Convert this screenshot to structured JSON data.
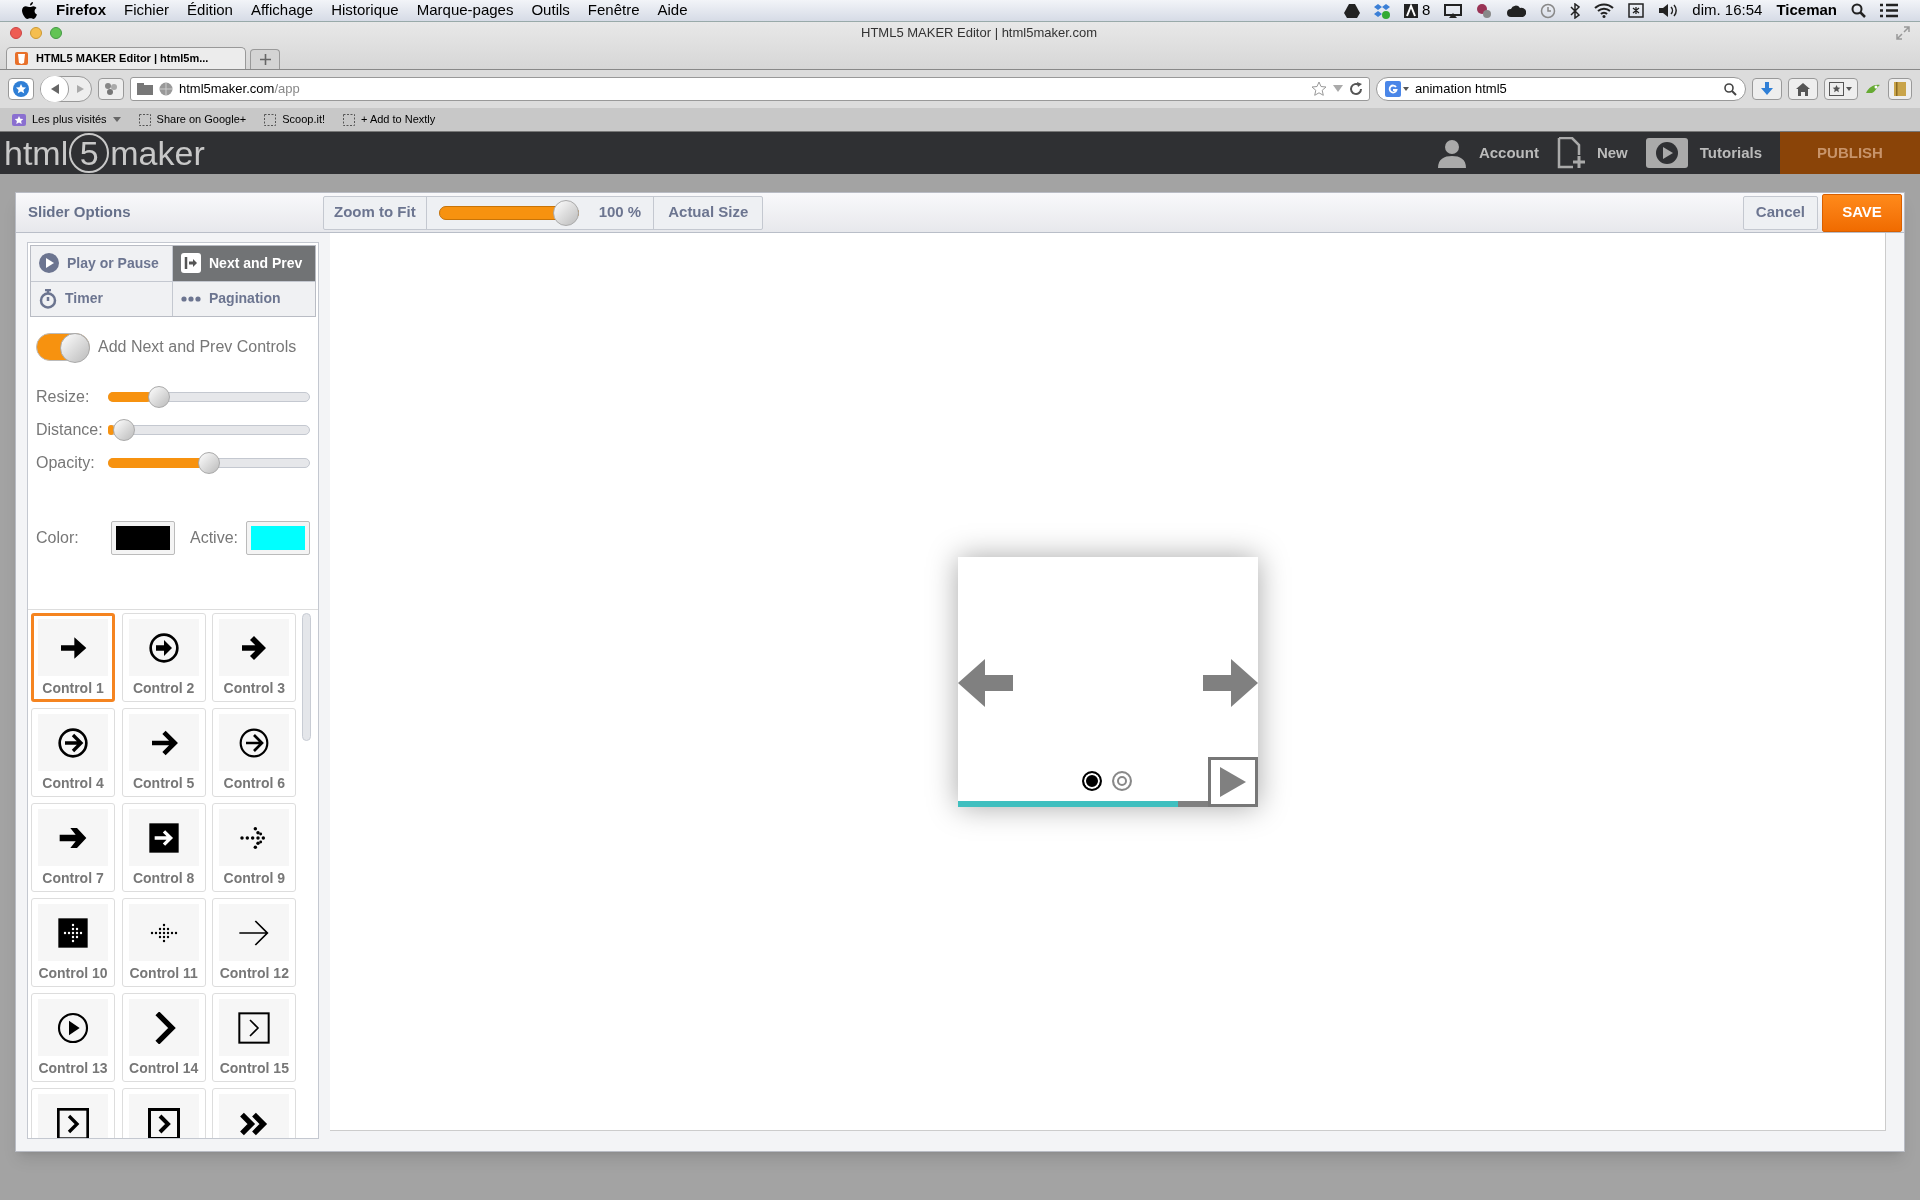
{
  "menu_bar": {
    "app": "Firefox",
    "items": [
      "Fichier",
      "Édition",
      "Affichage",
      "Historique",
      "Marque-pages",
      "Outils",
      "Fenêtre",
      "Aide"
    ],
    "badge_count": "8",
    "clock": "dim. 16:54",
    "user": "Ticeman"
  },
  "window": {
    "title": "HTML5 MAKER Editor | html5maker.com"
  },
  "browser_tabs": [
    {
      "label": "HTML5 MAKER Editor | html5m...",
      "selected": true
    }
  ],
  "address_bar": {
    "host": "html5maker.com",
    "path": "/app"
  },
  "search_field": {
    "value": "animation html5"
  },
  "bookmarks": [
    "Les plus visités",
    "Share on Google+",
    "Scoop.it!",
    "+ Add to Nextly"
  ],
  "app_header": {
    "logo": [
      "html",
      "5",
      "maker"
    ],
    "nav": [
      "Account",
      "New",
      "Tutorials"
    ],
    "publish": "PUBLISH"
  },
  "dialog": {
    "title": "Slider Options",
    "zoom_to_fit": "Zoom to Fit",
    "zoom": {
      "level": 1.0,
      "reading": "100 %"
    },
    "actual_size": "Actual Size",
    "cancel": "Cancel",
    "save": "SAVE"
  },
  "option_tabs": [
    {
      "label": "Play or Pause",
      "kind": "play",
      "selected": false
    },
    {
      "label": "Next and Prev",
      "kind": "nextprev",
      "selected": true
    },
    {
      "label": "Timer",
      "kind": "timer",
      "selected": false
    },
    {
      "label": "Pagination",
      "kind": "pagination",
      "selected": false
    }
  ],
  "toggle": {
    "label": "Add Next and Prev Controls",
    "on": true
  },
  "sliders": [
    {
      "label": "Resize:",
      "level": 0.22
    },
    {
      "label": "Distance:",
      "level": 0.03
    },
    {
      "label": "Opacity:",
      "level": 0.5
    }
  ],
  "swatches": [
    {
      "label": "Color:",
      "color": "#000000"
    },
    {
      "label": "Active:",
      "color": "#00ffff"
    }
  ],
  "controls": [
    {
      "label": "Control 1",
      "selected": true
    },
    {
      "label": "Control 2",
      "selected": false
    },
    {
      "label": "Control 3",
      "selected": false
    },
    {
      "label": "Control 4",
      "selected": false
    },
    {
      "label": "Control 5",
      "selected": false
    },
    {
      "label": "Control 6",
      "selected": false
    },
    {
      "label": "Control 7",
      "selected": false
    },
    {
      "label": "Control 8",
      "selected": false
    },
    {
      "label": "Control 9",
      "selected": false
    },
    {
      "label": "Control 10",
      "selected": false
    },
    {
      "label": "Control 11",
      "selected": false
    },
    {
      "label": "Control 12",
      "selected": false
    },
    {
      "label": "Control 13",
      "selected": false
    },
    {
      "label": "Control 14",
      "selected": false
    },
    {
      "label": "Control 15",
      "selected": false
    },
    {
      "selected": false
    },
    {
      "selected": false
    },
    {
      "selected": false
    }
  ],
  "preview": {
    "pagination": [
      {
        "selected": true
      },
      {
        "selected": false
      }
    ],
    "progress": {
      "level": 0.88
    }
  }
}
